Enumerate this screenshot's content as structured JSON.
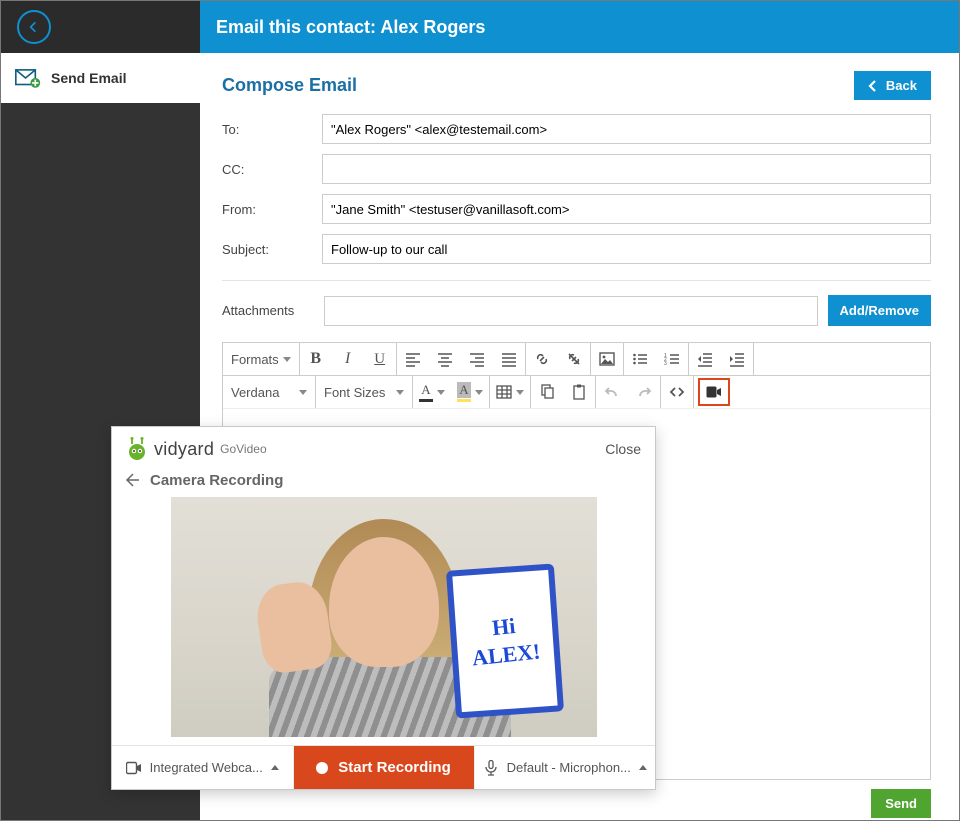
{
  "header": {
    "title": "Email this contact: Alex Rogers"
  },
  "sidebar": {
    "send_email": "Send Email"
  },
  "compose": {
    "title": "Compose Email",
    "back_label": "Back",
    "labels": {
      "to": "To:",
      "cc": "CC:",
      "from": "From:",
      "subject": "Subject:",
      "attachments": "Attachments"
    },
    "to_value": "\"Alex Rogers\" <alex@testemail.com>",
    "cc_value": "",
    "from_value": "\"Jane Smith\" <testuser@vanillasoft.com>",
    "subject_value": "Follow-up to our call",
    "attachments_value": "",
    "add_remove": "Add/Remove",
    "send": "Send"
  },
  "toolbar": {
    "formats": "Formats",
    "font_family": "Verdana",
    "font_sizes": "Font Sizes"
  },
  "vidyard": {
    "brand_main": "vidyard",
    "brand_sub": "GoVideo",
    "close": "Close",
    "mode": "Camera Recording",
    "whiteboard_line1": "Hi",
    "whiteboard_line2": "ALEX!",
    "camera_device": "Integrated Webca...",
    "mic_device": "Default - Microphon...",
    "start_recording": "Start Recording"
  }
}
